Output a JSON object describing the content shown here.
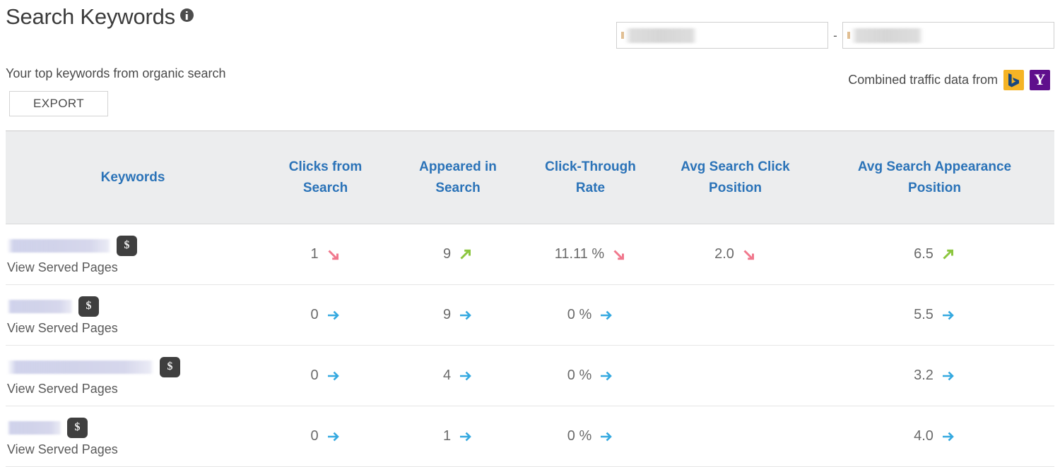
{
  "header": {
    "title": "Search Keywords",
    "info_icon": "info-icon",
    "subtitle": "Your top keywords from organic search",
    "export_label": "EXPORT"
  },
  "date_range": {
    "start_value": "",
    "end_value": "",
    "separator": "-",
    "start_placeholder": "",
    "end_placeholder": ""
  },
  "traffic_source": {
    "label": "Combined traffic data from",
    "engines": [
      {
        "name": "bing-icon",
        "glyph": "b",
        "color": "#f5b425"
      },
      {
        "name": "yahoo-icon",
        "glyph": "Y",
        "color": "#5f0f8c"
      }
    ]
  },
  "colors": {
    "header_text": "#2b73b8",
    "header_bg": "#ecedee",
    "arrow_down": "#f0788d",
    "arrow_up": "#8cc63f",
    "arrow_flat": "#35a9e0",
    "badge_bg": "#3f3f3f"
  },
  "table": {
    "columns": [
      "Keywords",
      "Clicks from Search",
      "Appeared in Search",
      "Click-Through Rate",
      "Avg Search Click Position",
      "Avg Search Appearance Position"
    ],
    "columns_lines": [
      [
        "Keywords"
      ],
      [
        "Clicks from",
        "Search"
      ],
      [
        "Appeared in",
        "Search"
      ],
      [
        "Click-Through",
        "Rate"
      ],
      [
        "Avg Search Click",
        "Position"
      ],
      [
        "Avg Search Appearance",
        "Position"
      ]
    ],
    "served_pages_label": "View Served Pages",
    "money_badge_glyph": "$",
    "rows": [
      {
        "keyword": "",
        "keyword_redacted_width": 147,
        "clicks": {
          "value": "1",
          "trend": "down"
        },
        "appeared": {
          "value": "9",
          "trend": "up"
        },
        "ctr": {
          "value": "11.11 %",
          "trend": "down"
        },
        "click_position": {
          "value": "2.0",
          "trend": "down"
        },
        "appearance_position": {
          "value": "6.5",
          "trend": "up"
        }
      },
      {
        "keyword": "",
        "keyword_redacted_width": 93,
        "clicks": {
          "value": "0",
          "trend": "flat"
        },
        "appeared": {
          "value": "9",
          "trend": "flat"
        },
        "ctr": {
          "value": "0 %",
          "trend": "flat"
        },
        "click_position": {
          "value": "",
          "trend": "none"
        },
        "appearance_position": {
          "value": "5.5",
          "trend": "flat"
        }
      },
      {
        "keyword": "",
        "keyword_redacted_width": 208,
        "clicks": {
          "value": "0",
          "trend": "flat"
        },
        "appeared": {
          "value": "4",
          "trend": "flat"
        },
        "ctr": {
          "value": "0 %",
          "trend": "flat"
        },
        "click_position": {
          "value": "",
          "trend": "none"
        },
        "appearance_position": {
          "value": "3.2",
          "trend": "flat"
        }
      },
      {
        "keyword": "",
        "keyword_redacted_width": 77,
        "clicks": {
          "value": "0",
          "trend": "flat"
        },
        "appeared": {
          "value": "1",
          "trend": "flat"
        },
        "ctr": {
          "value": "0 %",
          "trend": "flat"
        },
        "click_position": {
          "value": "",
          "trend": "none"
        },
        "appearance_position": {
          "value": "4.0",
          "trend": "flat"
        }
      }
    ]
  }
}
